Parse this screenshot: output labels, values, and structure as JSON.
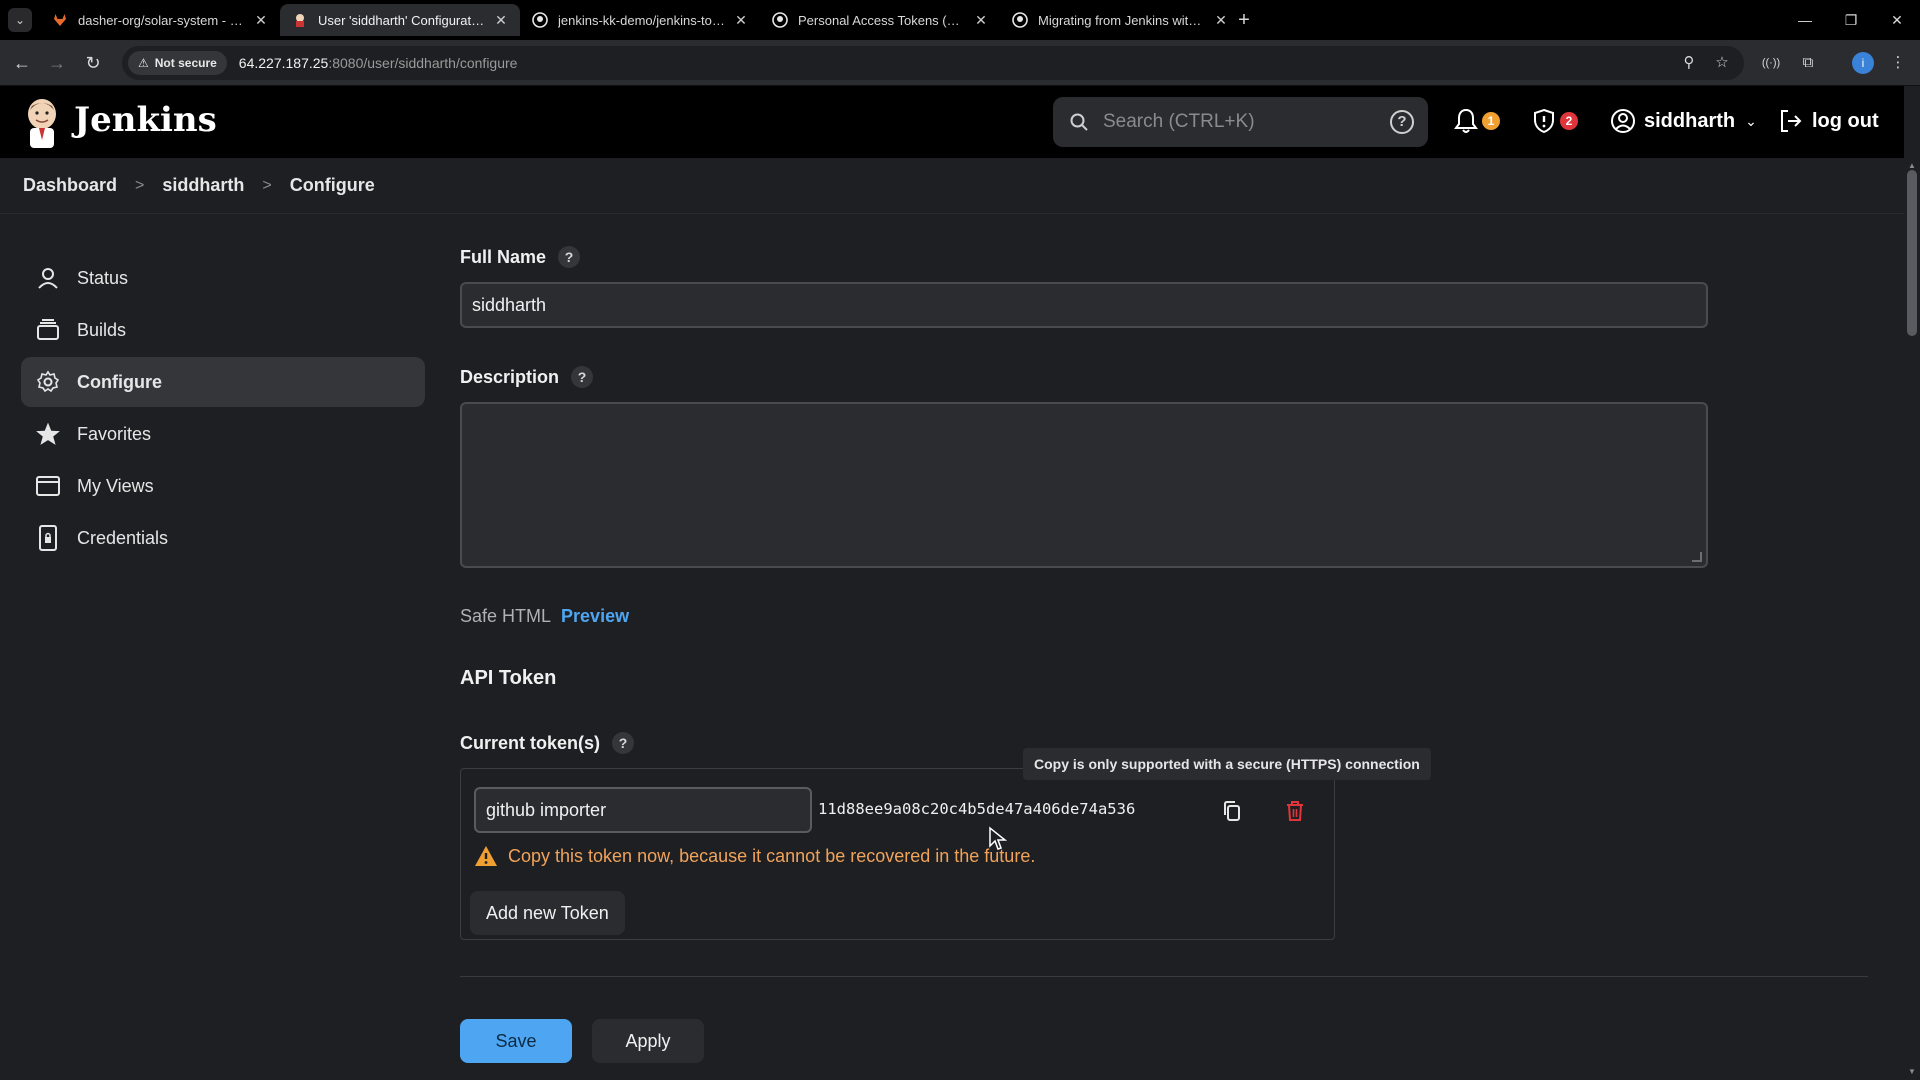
{
  "browser": {
    "tabs": [
      {
        "label": "dasher-org/solar-system - solar",
        "active": false,
        "icon": "gitlab-fox-icon"
      },
      {
        "label": "User 'siddharth' Configuration [",
        "active": true,
        "icon": "jenkins-favicon-icon"
      },
      {
        "label": "jenkins-kk-demo/jenkins-to-act",
        "active": false,
        "icon": "github-icon"
      },
      {
        "label": "Personal Access Tokens (Classic",
        "active": false,
        "icon": "github-icon"
      },
      {
        "label": "Migrating from Jenkins with Git",
        "active": false,
        "icon": "github-icon"
      }
    ],
    "address": {
      "security_label": "Not secure",
      "host": "64.227.187.25",
      "path": ":8080/user/siddharth/configure"
    },
    "profile_initial": "i"
  },
  "header": {
    "title": "Jenkins",
    "search_placeholder": "Search (CTRL+K)",
    "notifications_count": "1",
    "security_count": "2",
    "username": "siddharth",
    "logout_label": "log out",
    "colors": {
      "notification_badge": "#f0a030",
      "security_badge": "#e0353a"
    }
  },
  "breadcrumb": [
    "Dashboard",
    "siddharth",
    "Configure"
  ],
  "sidebar": {
    "items": [
      {
        "label": "Status",
        "icon": "person-icon",
        "active": false
      },
      {
        "label": "Builds",
        "icon": "builds-stack-icon",
        "active": false
      },
      {
        "label": "Configure",
        "icon": "gear-icon",
        "active": true
      },
      {
        "label": "Favorites",
        "icon": "star-icon",
        "active": false
      },
      {
        "label": "My Views",
        "icon": "window-icon",
        "active": false
      },
      {
        "label": "Credentials",
        "icon": "tablet-lock-icon",
        "active": false
      }
    ]
  },
  "form": {
    "full_name_label": "Full Name",
    "full_name_value": "siddharth",
    "description_label": "Description",
    "description_value": "",
    "safe_html_label": "Safe HTML",
    "preview_label": "Preview",
    "api_token_title": "API Token",
    "current_tokens_label": "Current token(s)",
    "token": {
      "name": "github importer",
      "value": "11d88ee9a08c20c4b5de47a406de74a536",
      "warning": "Copy this token now, because it cannot be recovered in the future."
    },
    "copy_tooltip": "Copy is only supported with a secure (HTTPS) connection",
    "add_token_label": "Add new Token",
    "save_label": "Save",
    "apply_label": "Apply"
  }
}
